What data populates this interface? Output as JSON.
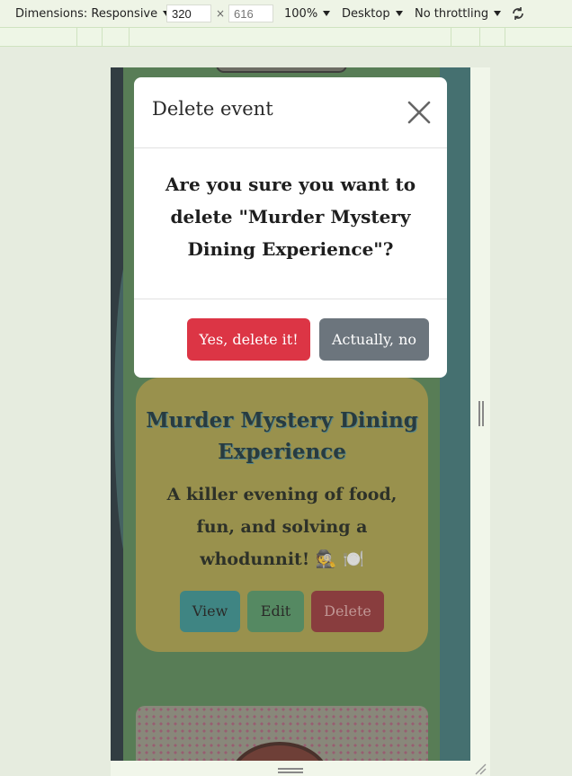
{
  "devtools": {
    "dimensions_label": "Dimensions: Responsive",
    "width_value": "320",
    "height_placeholder": "616",
    "times": "×",
    "zoom": "100%",
    "device_type": "Desktop",
    "throttling": "No throttling"
  },
  "modal": {
    "title": "Delete event",
    "question": "Are you sure you want to delete \"Murder Mystery Dining Experience\"?",
    "confirm_label": "Yes, delete it!",
    "cancel_label": "Actually, no"
  },
  "event_card": {
    "title": "Murder Mystery Dining Experience",
    "description": "A killer evening of food, fun, and solving a whodunnit! 🕵️ 🍽️",
    "buttons": {
      "view": "View",
      "edit": "Edit",
      "delete": "Delete"
    }
  },
  "colors": {
    "confirm_button": "#dc3545",
    "cancel_button": "#6c757d",
    "card_background": "#a59a42"
  }
}
